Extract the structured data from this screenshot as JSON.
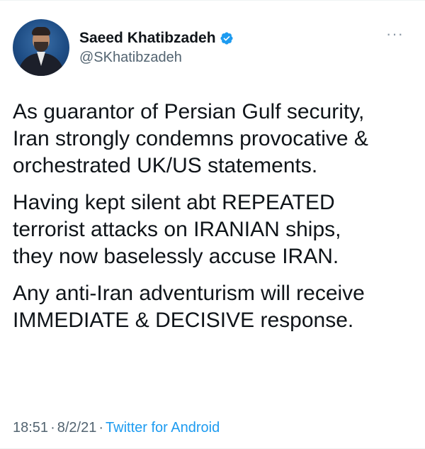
{
  "author": {
    "display_name": "Saeed Khatibzadeh",
    "handle": "@SKhatibzadeh",
    "verified_icon": "verified-badge-icon"
  },
  "more_icon": "more-options-icon",
  "tweet": {
    "paragraphs": [
      "As guarantor of Persian Gulf security,\nIran strongly condemns provocative &\norchestrated UK/US statements.",
      "Having kept silent abt REPEATED\nterrorist attacks on IRANIAN ships,\nthey now baselessly accuse IRAN.",
      "Any anti-Iran adventurism will receive\nIMMEDIATE & DECISIVE response."
    ]
  },
  "meta": {
    "time": "18:51",
    "date": "8/2/21",
    "separator": "·",
    "source": "Twitter for Android"
  },
  "colors": {
    "accent": "#1d9bf0",
    "text": "#0f1419",
    "muted": "#536471"
  }
}
